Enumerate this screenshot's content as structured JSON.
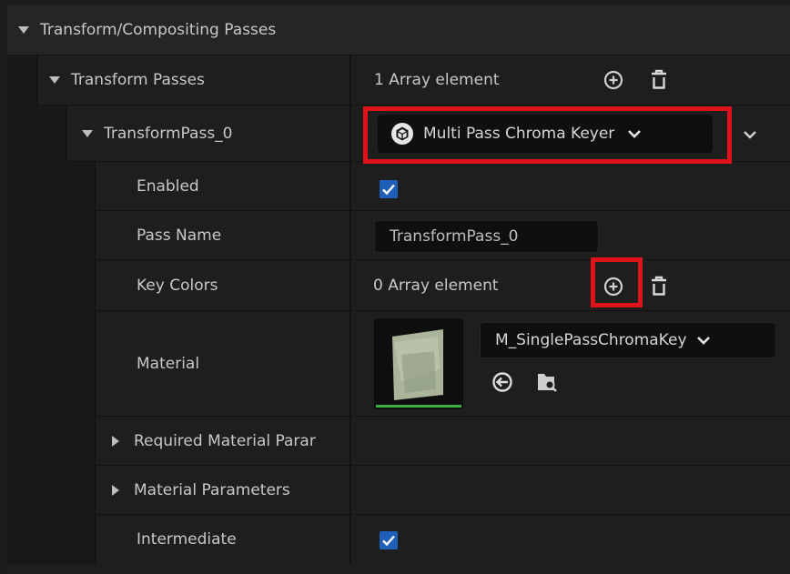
{
  "category": {
    "label": "Transform/Compositing Passes"
  },
  "transform_passes": {
    "label": "Transform Passes",
    "count_text": "1 Array element"
  },
  "transform_pass_0": {
    "label": "TransformPass_0",
    "type_value": "Multi Pass Chroma Keyer"
  },
  "enabled": {
    "label": "Enabled",
    "checked": true
  },
  "pass_name": {
    "label": "Pass Name",
    "value": "TransformPass_0"
  },
  "key_colors": {
    "label": "Key Colors",
    "count_text": "0 Array element"
  },
  "material": {
    "label": "Material",
    "asset_name": "M_SinglePassChromaKey"
  },
  "required_material_params": {
    "label": "Required Material Parar"
  },
  "material_params": {
    "label": "Material Parameters"
  },
  "intermediate": {
    "label": "Intermediate",
    "checked": true
  },
  "colors": {
    "background": "#1e1e1e",
    "checkbox": "#1f5fb8",
    "highlight": "#e0121c",
    "thumbnail_underline": "#3cb043"
  },
  "icons": [
    "expand-arrow-icon",
    "add-circle-icon",
    "trash-icon",
    "cube-icon",
    "chevron-down-icon",
    "use-selected-icon",
    "browse-folder-icon",
    "checkmark-icon"
  ]
}
